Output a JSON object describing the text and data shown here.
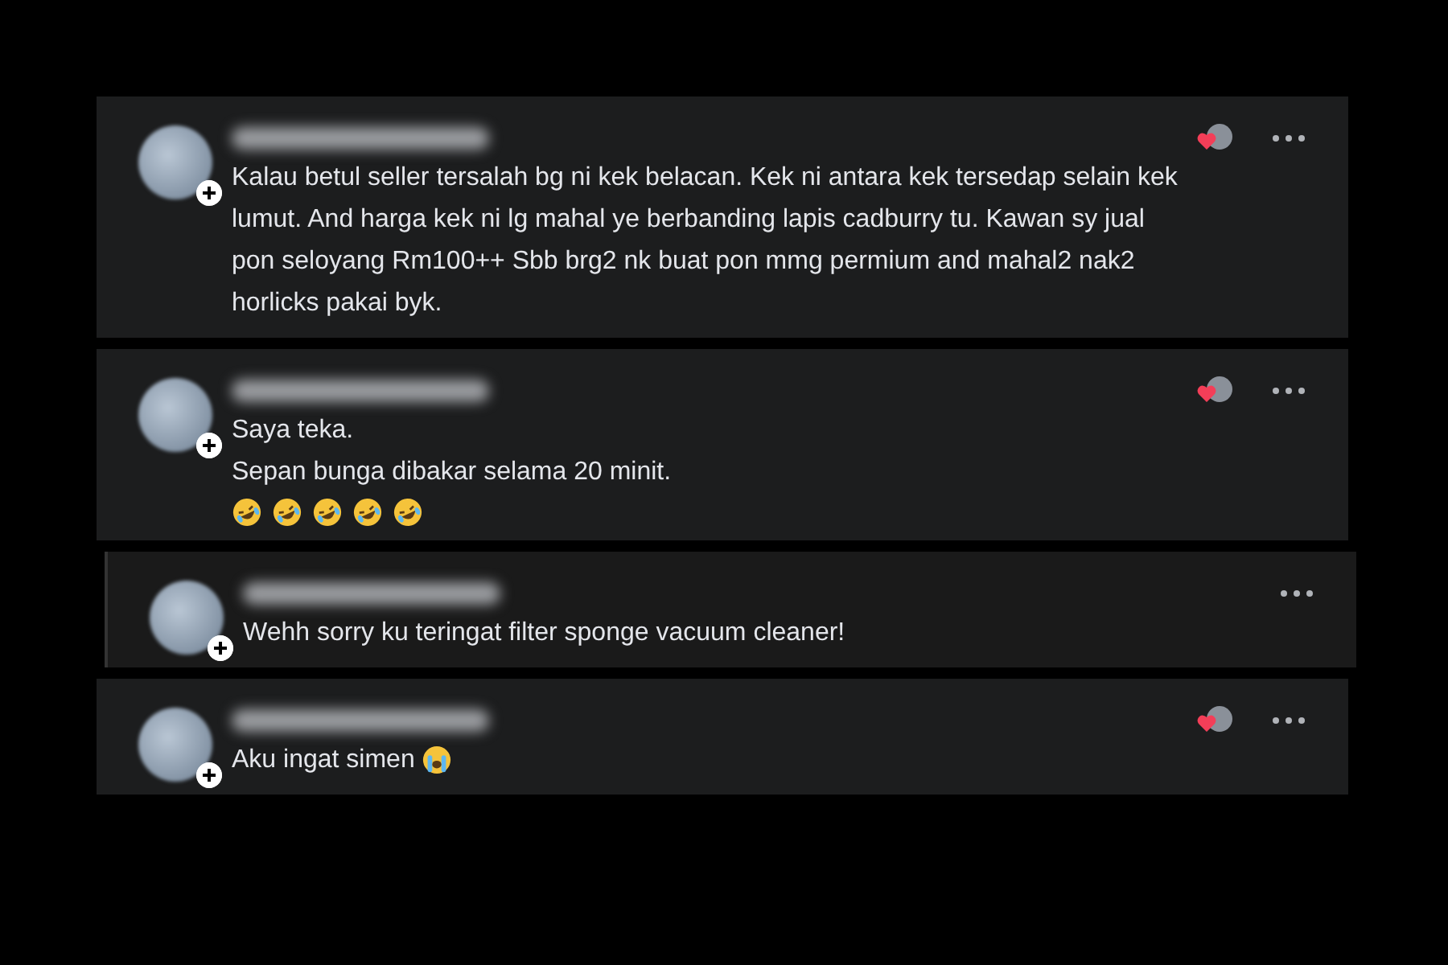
{
  "comments": [
    {
      "indent": false,
      "reacted": true,
      "lines": [
        "Kalau betul seller tersalah bg ni kek belacan. Kek ni antara kek tersedap selain kek",
        "lumut. And harga kek ni lg mahal ye berbanding lapis cadburry tu. Kawan sy jual",
        "pon seloyang Rm100++ Sbb brg2 nk buat pon mmg permium and mahal2 nak2",
        "horlicks pakai byk."
      ]
    },
    {
      "indent": false,
      "reacted": true,
      "lines": [
        "Saya teka.",
        "Sepan bunga dibakar selama 20 minit."
      ],
      "emojis": [
        {
          "kind": "laughing"
        },
        {
          "kind": "laughing"
        },
        {
          "kind": "laughing"
        },
        {
          "kind": "laughing"
        },
        {
          "kind": "laughing"
        }
      ]
    },
    {
      "indent": true,
      "reacted": false,
      "lines": [
        "Wehh sorry ku teringat filter sponge vacuum cleaner!"
      ]
    },
    {
      "indent": false,
      "reacted": true,
      "lines": [
        "Aku ingat simen"
      ],
      "emojis": [
        {
          "kind": "crying"
        }
      ]
    }
  ]
}
